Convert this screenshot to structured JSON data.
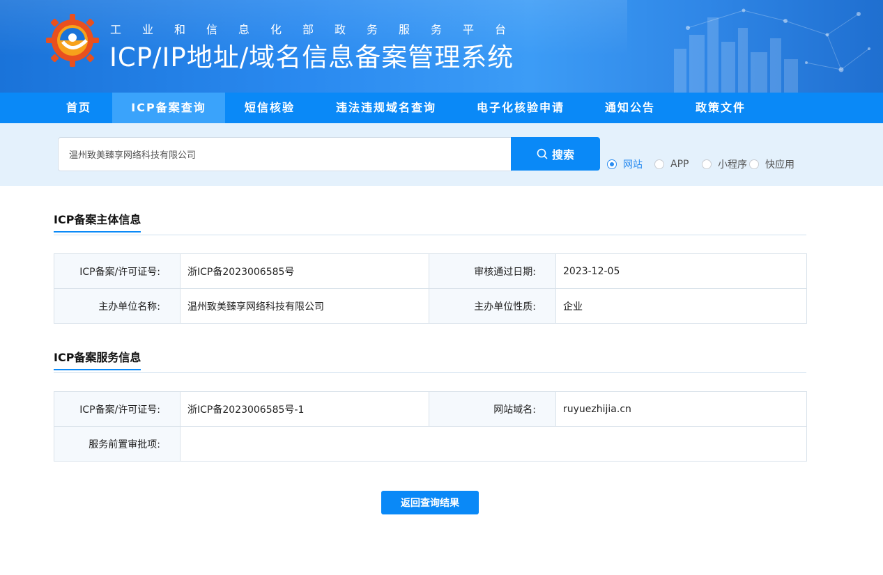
{
  "header": {
    "subtitle": "工业和信息化部政务服务平台",
    "title": "ICP/IP地址/域名信息备案管理系统"
  },
  "nav": {
    "items": [
      {
        "label": "首页"
      },
      {
        "label": "ICP备案查询",
        "active": true
      },
      {
        "label": "短信核验"
      },
      {
        "label": "违法违规域名查询"
      },
      {
        "label": "电子化核验申请"
      },
      {
        "label": "通知公告"
      },
      {
        "label": "政策文件"
      }
    ]
  },
  "search": {
    "value": "温州致美臻享网络科技有限公司",
    "button_label": "搜索",
    "options": [
      {
        "label": "网站",
        "checked": true
      },
      {
        "label": "APP",
        "checked": false
      },
      {
        "label": "小程序",
        "checked": false
      },
      {
        "label": "快应用",
        "checked": false
      }
    ]
  },
  "subject_info": {
    "title": "ICP备案主体信息",
    "rows": [
      {
        "k1": "ICP备案/许可证号:",
        "v1": "浙ICP备2023006585号",
        "k2": "审核通过日期:",
        "v2": "2023-12-05"
      },
      {
        "k1": "主办单位名称:",
        "v1": "温州致美臻享网络科技有限公司",
        "k2": "主办单位性质:",
        "v2": "企业"
      }
    ]
  },
  "service_info": {
    "title": "ICP备案服务信息",
    "row1": {
      "k1": "ICP备案/许可证号:",
      "v1": "浙ICP备2023006585号-1",
      "k2": "网站域名:",
      "v2": "ruyuezhijia.cn"
    },
    "row2": {
      "k1": "服务前置审批项:",
      "v1": ""
    }
  },
  "back_button": "返回查询结果",
  "colors": {
    "accent": "#0a89f7",
    "nav_active": "#3aa3fb",
    "search_band": "#e4f1fc",
    "key_cell": "#f5f9fd"
  }
}
